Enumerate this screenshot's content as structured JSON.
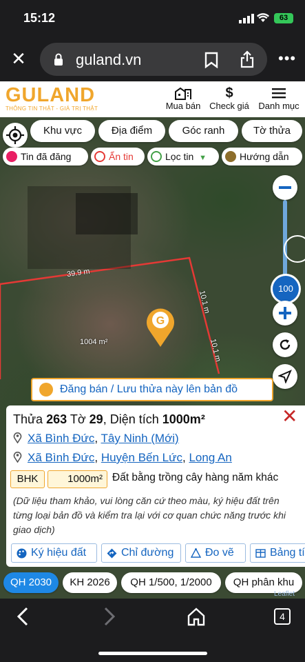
{
  "status": {
    "time": "15:12",
    "battery": "63"
  },
  "browser": {
    "url": "guland.vn"
  },
  "site": {
    "logo": "GULAND",
    "tagline": "THÔNG TIN THẬT - GIÁ TRỊ THẬT",
    "nav": [
      {
        "label": "Mua bán",
        "icon": "building-icon"
      },
      {
        "label": "Check giá",
        "icon": "dollar-icon"
      },
      {
        "label": "Danh mục",
        "icon": "menu-icon"
      }
    ]
  },
  "filters": {
    "row1": [
      "Khu vực",
      "Địa điểm",
      "Góc ranh",
      "Tờ thửa"
    ],
    "row2": [
      {
        "label": "Tin đã đăng",
        "color": "#e91e63"
      },
      {
        "label": "Ẩn tin",
        "color": "#e53935"
      },
      {
        "label": "Lọc tin",
        "color": "#43a047"
      },
      {
        "label": "Hướng dẫn",
        "color": "#8d6e2b"
      }
    ]
  },
  "map": {
    "edge_top": "39.9 m",
    "edge_right1": "10.1 m",
    "edge_right2": "10.1 m",
    "area_label": "1004 m²",
    "zoom_value": "100",
    "promo": "Đăng bán / Lưu thửa này lên bản đồ",
    "leaflet": "Leaflet"
  },
  "parcel": {
    "title_prefix": "Thửa",
    "parcel_no": "263",
    "sheet_prefix": "Tờ",
    "sheet_no": "29",
    "area_prefix": "Diện tích",
    "area": "1000m²",
    "address1": {
      "commune": "Xã Bình Đức",
      "province": "Tây Ninh (Mới)"
    },
    "address2": {
      "commune": "Xã Bình Đức",
      "district": "Huyện Bến Lức",
      "province": "Long An"
    },
    "land_code": "BHK",
    "land_area": "1000m²",
    "land_desc": "Đất bằng trồng cây hàng năm khác",
    "note": "(Dữ liệu tham khảo, vui lòng căn cứ theo màu, ký hiệu đất trên từng loại bản đồ và kiểm tra lại với cơ quan chức năng trước khi giao dịch)",
    "actions": [
      "Ký hiệu đất",
      "Chỉ đường",
      "Đo vẽ",
      "Bảng tính"
    ]
  },
  "plans": [
    {
      "label": "QH 2030",
      "active": true
    },
    {
      "label": "KH 2026",
      "active": false
    },
    {
      "label": "QH 1/500, 1/2000",
      "active": false
    },
    {
      "label": "QH phân khu",
      "active": false
    }
  ],
  "bottom": {
    "tab_count": "4"
  }
}
